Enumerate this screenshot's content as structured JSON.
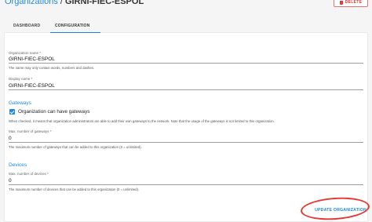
{
  "breadcrumb": {
    "parent": "Organizations",
    "separator": "/",
    "current": "GIRNI-FIEC-ESPOL"
  },
  "header": {
    "delete_label": "DELETE"
  },
  "tabs": [
    {
      "label": "DASHBOARD",
      "active": false
    },
    {
      "label": "CONFIGURATION",
      "active": true
    }
  ],
  "form": {
    "org_name": {
      "label": "Organization name *",
      "value": "GIRNI-FIEC-ESPOL",
      "help": "The name may only contain words, numbers and dashes."
    },
    "display_name": {
      "label": "Display name *",
      "value": "GIRNI-FIEC-ESPOL"
    },
    "gateways": {
      "section_title": "Gateways",
      "checkbox_label": "Organization can have gateways",
      "checked": true,
      "checkbox_help": "When checked, it means that organization administrators are able to add their own gateways to the network. Note that the usage of the gateways is not limited to this organization.",
      "max_label": "Max. number of gateways *",
      "max_value": "0",
      "max_help": "The maximum number of gateways that can be added to this organization (0 = unlimited)."
    },
    "devices": {
      "section_title": "Devices",
      "max_label": "Max. number of devices *",
      "max_value": "0",
      "max_help": "The maximum number of devices that can be added to this organization (0 = unlimited)."
    },
    "submit_label": "UPDATE ORGANIZATION"
  },
  "colors": {
    "accent": "#1e88e5",
    "danger": "#e53935",
    "background": "#f5f5f5"
  }
}
